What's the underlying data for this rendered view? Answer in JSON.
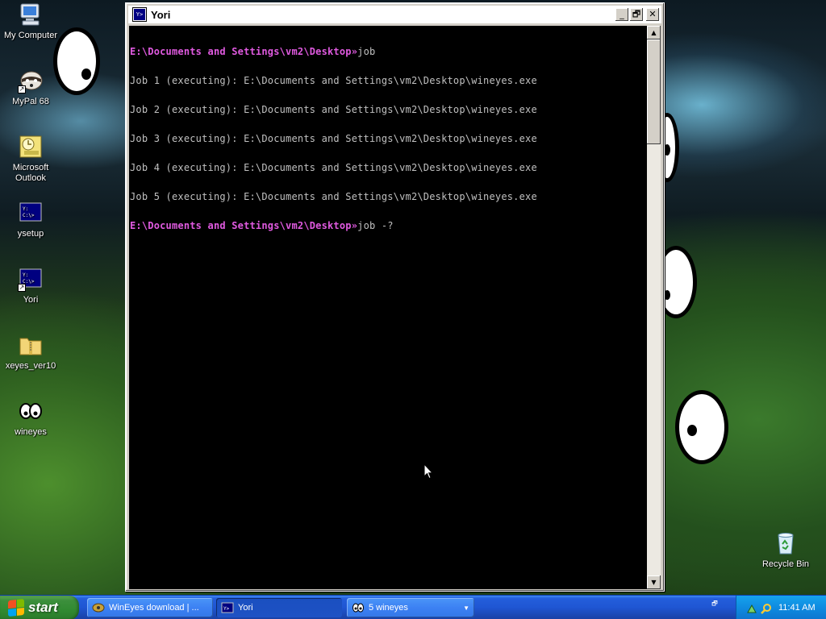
{
  "desktop": {
    "icons": [
      {
        "label": "My Computer"
      },
      {
        "label": "MyPal 68"
      },
      {
        "label": "Microsoft Outlook"
      },
      {
        "label": "ysetup"
      },
      {
        "label": "Yori"
      },
      {
        "label": "xeyes_ver10"
      },
      {
        "label": "wineyes"
      },
      {
        "label": "Recycle Bin"
      }
    ]
  },
  "window": {
    "title": "Yori",
    "icon": "yori-console-icon",
    "buttons": {
      "minimize": "_",
      "maximize": "🗗",
      "close": "✕"
    }
  },
  "console": {
    "lines": [
      {
        "prompt": "E:\\Documents and Settings\\vm2\\Desktop»",
        "command": "job"
      },
      {
        "text": "Job 1 (executing): E:\\Documents and Settings\\vm2\\Desktop\\wineyes.exe"
      },
      {
        "text": "Job 2 (executing): E:\\Documents and Settings\\vm2\\Desktop\\wineyes.exe"
      },
      {
        "text": "Job 3 (executing): E:\\Documents and Settings\\vm2\\Desktop\\wineyes.exe"
      },
      {
        "text": "Job 4 (executing): E:\\Documents and Settings\\vm2\\Desktop\\wineyes.exe"
      },
      {
        "text": "Job 5 (executing): E:\\Documents and Settings\\vm2\\Desktop\\wineyes.exe"
      },
      {
        "prompt": "E:\\Documents and Settings\\vm2\\Desktop»",
        "command": "job -?"
      }
    ],
    "colors": {
      "prompt": "#e05ae0",
      "text": "#c0c0c0",
      "background": "#000000"
    }
  },
  "taskbar": {
    "start_label": "start",
    "tasks": [
      {
        "label": "WinEyes download | ...",
        "icon": "wineyes-icon",
        "active": false
      },
      {
        "label": "Yori",
        "icon": "yori-icon",
        "active": true
      },
      {
        "label": "5 wineyes",
        "icon": "eyes-icon",
        "active": false
      }
    ],
    "time": "11:41 AM"
  }
}
